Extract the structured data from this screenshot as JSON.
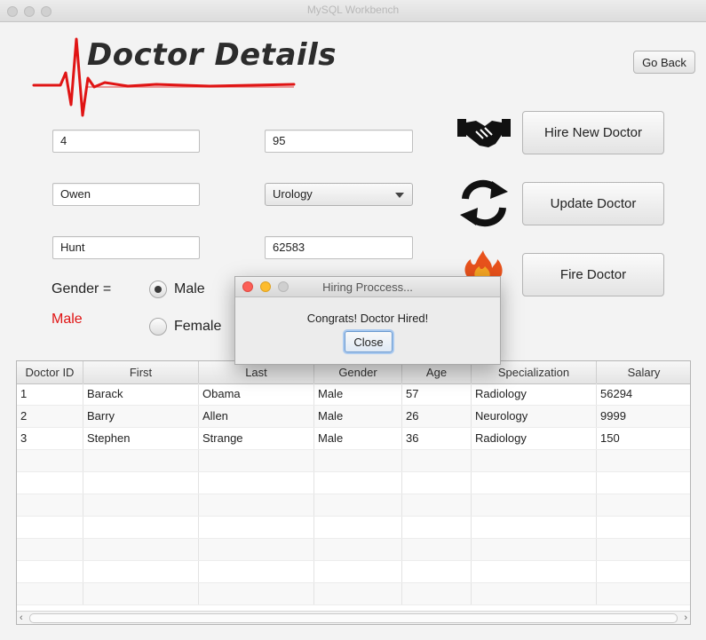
{
  "window": {
    "title": "MySQL Workbench"
  },
  "header": {
    "logo_text": "Doctor Details",
    "go_back_label": "Go Back"
  },
  "form": {
    "id_value": "4",
    "age_value": "95",
    "first_value": "Owen",
    "specialization_value": "Urology",
    "last_value": "Hunt",
    "salary_value": "62583",
    "gender_label": "Gender =",
    "gender_selected_text": "Male",
    "gender_options": [
      "Male",
      "Female"
    ]
  },
  "actions": {
    "hire_label": "Hire New Doctor",
    "update_label": "Update Doctor",
    "fire_label": "Fire Doctor"
  },
  "table": {
    "columns": [
      "Doctor ID",
      "First",
      "Last",
      "Gender",
      "Age",
      "Specialization",
      "Salary"
    ],
    "rows": [
      [
        "1",
        "Barack",
        "Obama",
        "Male",
        "57",
        "Radiology",
        "56294"
      ],
      [
        "2",
        "Barry",
        "Allen",
        "Male",
        "26",
        "Neurology",
        "9999"
      ],
      [
        "3",
        "Stephen",
        "Strange",
        "Male",
        "36",
        "Radiology",
        "150"
      ]
    ]
  },
  "dialog": {
    "title": "Hiring Proccess...",
    "message": "Congrats! Doctor Hired!",
    "close_label": "Close"
  },
  "colors": {
    "accent_red": "#e01414",
    "focus_blue": "#6b9ad0"
  }
}
